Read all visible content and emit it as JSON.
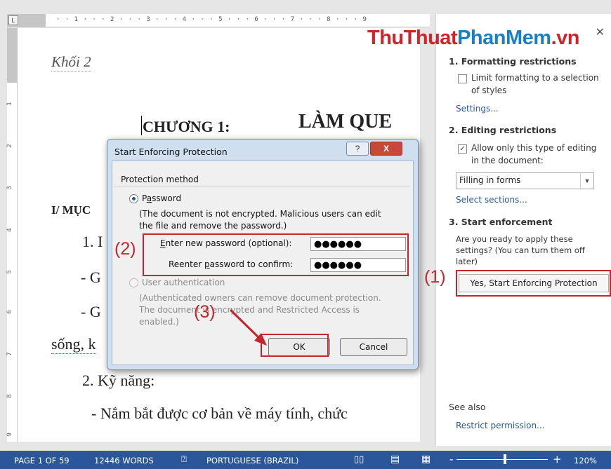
{
  "ruler": {
    "tab_selector": "L",
    "top_numbers": "· · 1 · · · 2 · · · 3 · · · 4 · · · 5 · · · 6 · · · 7 · · · 8 · · · 9",
    "left_numbers": [
      "1",
      "2",
      "3",
      "4",
      "5",
      "6",
      "7",
      "8",
      "9"
    ]
  },
  "document": {
    "khoi": "Khối 2",
    "chuong": "CHƯƠNG 1:",
    "lam_quen": "LÀM QUE",
    "muc": "I/ MỤC",
    "line1": "1. I",
    "dash_g1": "- G",
    "dash_g2": "- G",
    "song": "sống, k",
    "ky_nang": "2. Kỹ năng:",
    "nam_bat": "- Nắm bắt được cơ bản về máy tính, chức"
  },
  "watermark": {
    "part1": "ThuThuat",
    "part2": "PhanMem",
    "part3": ".vn"
  },
  "pane": {
    "close_icon": "✕",
    "formatting_heading": "1. Formatting restrictions",
    "formatting_check_line1": "Limit formatting to a selection",
    "formatting_check_line2": "of styles",
    "settings_link": "Settings...",
    "editing_heading": "2. Editing restrictions",
    "editing_check_line1": "Allow only this type of editing",
    "editing_check_line2": "in the document:",
    "editing_dropdown": "Filling in forms",
    "select_sections_link": "Select sections...",
    "enforcement_heading": "3. Start enforcement",
    "enforcement_text_line1": "Are you ready to apply these",
    "enforcement_text_line2": "settings? (You can turn them off",
    "enforcement_text_line3": "later)",
    "start_button": "Yes, Start Enforcing Protection",
    "see_also": "See also",
    "restrict_link": "Restrict permission..."
  },
  "dialog": {
    "title": "Start Enforcing Protection",
    "help_icon": "?",
    "close_icon": "X",
    "group_label": "Protection method",
    "password_option_pre": "P",
    "password_option_key": "a",
    "password_option_post": "ssword",
    "password_note_line1": "(The document is not encrypted. Malicious users can edit",
    "password_note_line2": "the file and remove the password.)",
    "enter_pw_pre": "",
    "enter_pw_key": "E",
    "enter_pw_post": "nter new password (optional):",
    "enter_pw_value": "●●●●●●",
    "reenter_pre": "Reenter ",
    "reenter_key": "p",
    "reenter_post": "assword to confirm:",
    "reenter_value": "●●●●●●",
    "user_auth": "User authentication",
    "user_auth_note_line1": "(Authenticated owners can remove document protection.",
    "user_auth_note_line2": "The document is encrypted and Restricted Access is",
    "user_auth_note_line3": "enabled.)",
    "ok_button": "OK",
    "cancel_button": "Cancel"
  },
  "annotations": {
    "step1": "(1)",
    "step2": "(2)",
    "step3": "(3)",
    "color": "#c4262e"
  },
  "status_bar": {
    "page": "PAGE 1 OF 59",
    "words": "12446 WORDS",
    "proofing_icon": "proofing-icon",
    "language": "PORTUGUESE (BRAZIL)",
    "zoom_minus": "-",
    "zoom_plus": "+",
    "zoom": "120%",
    "zoom_level_percent": 120
  }
}
